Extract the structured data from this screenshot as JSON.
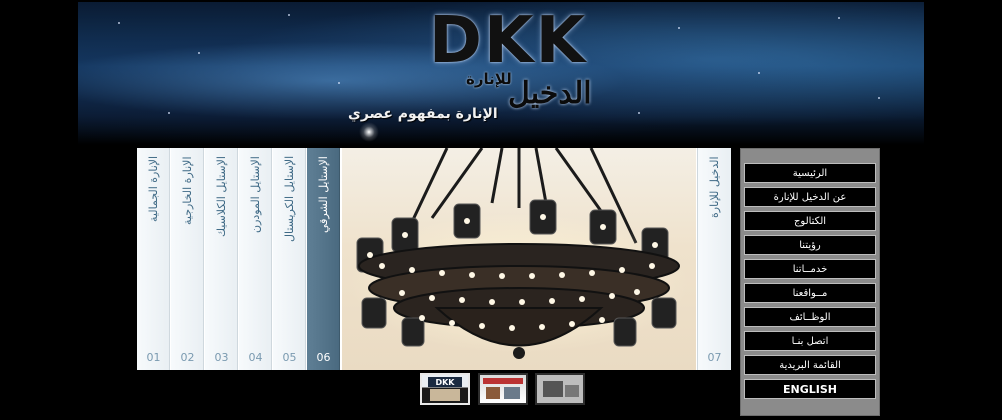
{
  "header": {
    "logo_latin": "DKK",
    "logo_arabic_main": "الدخيل",
    "logo_arabic_small": "للإنارة",
    "tagline": "الإنارة بمفهوم عصري"
  },
  "gallery": {
    "panels": [
      {
        "num": "01",
        "label": "الإنارة الجمالية",
        "active": false
      },
      {
        "num": "02",
        "label": "الإنارة الخارجية",
        "active": false
      },
      {
        "num": "03",
        "label": "الإستايل الكلاسيك",
        "active": false
      },
      {
        "num": "04",
        "label": "الإستايل المودرن",
        "active": false
      },
      {
        "num": "05",
        "label": "الإستايل الكريستال",
        "active": false
      },
      {
        "num": "06",
        "label": "الإستايل الشرقي",
        "active": true
      },
      {
        "num": "07",
        "label": "الدخيل للإنارة",
        "active": false
      }
    ],
    "photo_icon": "oriental-chandelier-photo"
  },
  "menu": {
    "items": [
      "الرئيسية",
      "عن الدخيل للإنارة",
      "الكتالوج",
      "رؤيتنا",
      "خدمــاتنا",
      "مــواقعنا",
      "الوظــائف",
      "اتصل بنـا",
      "القائمة البريدية",
      "ENGLISH"
    ]
  },
  "thumbnails": [
    "thumb-logo",
    "thumb-catalog",
    "thumb-showroom"
  ],
  "colors": {
    "background": "#000000",
    "menu_bg": "#8b8b8b",
    "menu_button": "#000000",
    "active_panel": "#5f7f95",
    "panel_text": "#3f6a86"
  }
}
